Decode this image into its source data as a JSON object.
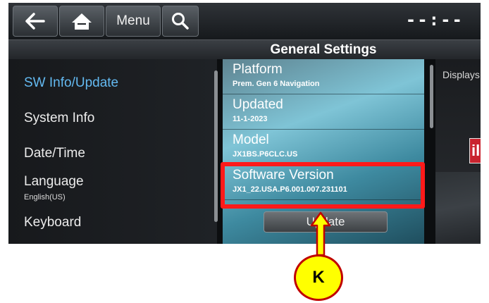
{
  "topbar": {
    "back_icon": "arrow-left-icon",
    "home_icon": "home-icon",
    "menu_label": "Menu",
    "search_icon": "search-icon",
    "clock": "--:--"
  },
  "header": {
    "title": "General Settings"
  },
  "left_menu": {
    "items": [
      {
        "label": "SW Info/Update",
        "selected": true
      },
      {
        "label": "System Info"
      },
      {
        "label": "Date/Time"
      },
      {
        "label": "Language",
        "sub": "English(US)"
      },
      {
        "label": "Keyboard"
      }
    ]
  },
  "details": {
    "items": [
      {
        "label": "Platform",
        "value": "Prem. Gen 6 Navigation"
      },
      {
        "label": "Updated",
        "value": "11-1-2023"
      },
      {
        "label": "Model",
        "value": "JX1BS.P6CLC.US"
      },
      {
        "label": "Software Version",
        "value": "JX1_22.USA.P6.001.007.231101"
      }
    ],
    "update_button": "Update"
  },
  "right_panel": {
    "text": "Displays",
    "tile_mark": "il"
  },
  "annotation": {
    "callout_label": "K",
    "highlight_color": "#ff1a1a",
    "callout_fill": "#ffff00",
    "callout_border": "#c00000"
  },
  "colors": {
    "selected_text": "#63b9f0"
  }
}
